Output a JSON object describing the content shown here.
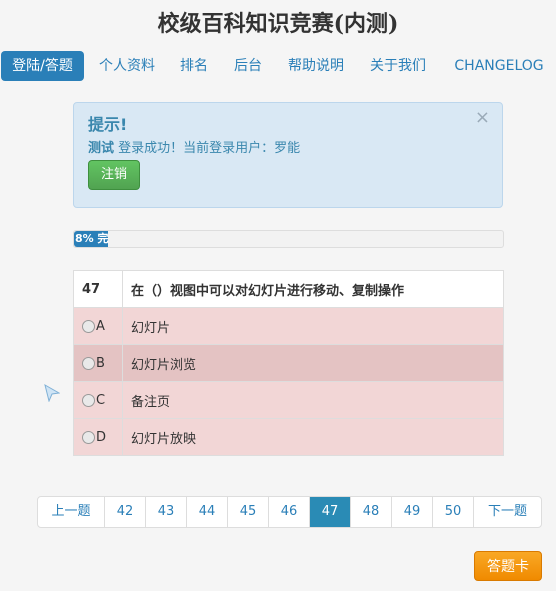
{
  "page_title": "校级百科知识竞赛(内测)",
  "nav": {
    "items": [
      "登陆/答题",
      "个人资料",
      "排名",
      "后台",
      "帮助说明",
      "关于我们",
      "CHANGELOG"
    ]
  },
  "alert": {
    "title": "提示!",
    "user_tag": "测试",
    "message": "登录成功！当前登录用户：罗能",
    "close": "×",
    "logout_label": "注销"
  },
  "progress": {
    "value_percent": 8,
    "label": "8% 完"
  },
  "question": {
    "number": "47",
    "text": "在（）视图中可以对幻灯片进行移动、复制操作",
    "options": [
      {
        "letter": "A",
        "text": "幻灯片"
      },
      {
        "letter": "B",
        "text": "幻灯片浏览"
      },
      {
        "letter": "C",
        "text": "备注页"
      },
      {
        "letter": "D",
        "text": "幻灯片放映"
      }
    ]
  },
  "pager": {
    "prev": "上一题",
    "pages": [
      "42",
      "43",
      "44",
      "45",
      "46",
      "47",
      "48",
      "49",
      "50"
    ],
    "current": "47",
    "next": "下一题"
  },
  "answer_card_label": "答题卡",
  "colors": {
    "accent": "#2a7fb8",
    "option_bg": "#f2d6d6",
    "logout": "#51a351",
    "card": "#f08a00"
  }
}
